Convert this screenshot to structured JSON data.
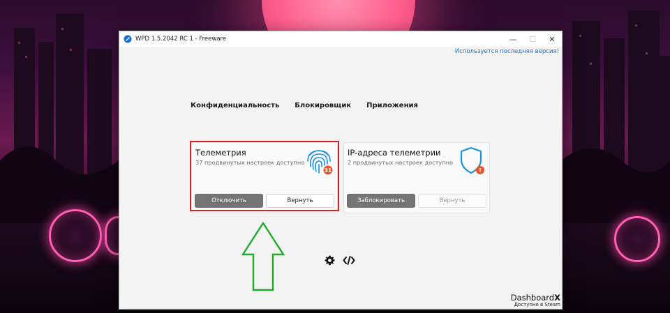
{
  "window": {
    "title": "WPD 1.5.2042 RC 1 - Freeware",
    "minimize_symbol": "—",
    "maximize_symbol": "☐",
    "close_symbol": "✕"
  },
  "version_status": "Используется последняя версия!",
  "nav": {
    "items": [
      {
        "label": "Конфиденциальность"
      },
      {
        "label": "Блокировщик"
      },
      {
        "label": "Приложения"
      }
    ]
  },
  "cards": [
    {
      "title": "Телеметрия",
      "subtitle": "37 продвинутых настроек доступно",
      "icon": "fingerprint-icon",
      "badge": "31",
      "primary_label": "Отключить",
      "secondary_label": "Вернуть"
    },
    {
      "title": "IP-адреса телеметрии",
      "subtitle": "2 продвинутых настроек доступно",
      "icon": "shield-alert-icon",
      "badge": "!",
      "primary_label": "Заблокировать",
      "secondary_label": "Вернуть"
    }
  ],
  "footer": {
    "icons": [
      "gear-icon",
      "code-icon"
    ],
    "brand_prefix": "Dashboard",
    "brand_suffix": "X",
    "brand_sub": "Доступно в Steam"
  },
  "colors": {
    "accent_blue": "#1a73c9",
    "icon_blue": "#1a8fe3",
    "badge_orange": "#e8552a",
    "highlight_red": "#d81e28",
    "arrow_green": "#1faa2e"
  }
}
